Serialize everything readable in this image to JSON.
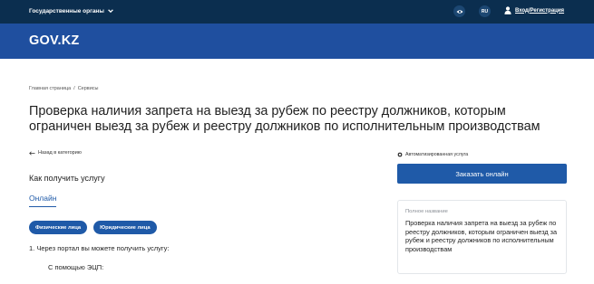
{
  "topbar": {
    "agencies_label": "Государственные органы",
    "lang": "RU",
    "login_label": "Вход/Регистрация"
  },
  "brand": {
    "logo": "GOV.KZ"
  },
  "breadcrumb": {
    "home": "Главная страница",
    "separator": "/",
    "section": "Сервисы"
  },
  "page": {
    "title": "Проверка наличия запрета на выезд за рубеж по реестру должников, которым ограничен выезд за рубеж и реестру должников по исполнительным производствам",
    "back_link": "Назад в категорию",
    "howto": "Как получить услугу",
    "tab_online": "Онлайн",
    "pills": [
      "Физические лица",
      "Юридические лица"
    ],
    "step1": "1. Через портал вы можете получить услугу:",
    "step1_sub": "С помощью ЭЦП:"
  },
  "sidebar": {
    "auto_label": "Автоматизированная услуга",
    "order_button": "Заказать онлайн",
    "card_label": "Полное название",
    "card_text": "Проверка наличия запрета на выезд за рубеж по реестру должников, которым ограничен выезд за рубеж и реестру должников по исполнительным производствам"
  },
  "icons": {
    "chevron": "chevron-down-icon",
    "eye": "eye-icon",
    "user": "user-icon",
    "back": "arrow-left-icon",
    "gear": "gear-icon"
  },
  "colors": {
    "topbar": "#0b2e4f",
    "brandbar": "#1f4f9f",
    "accent": "#1f5aa8"
  }
}
